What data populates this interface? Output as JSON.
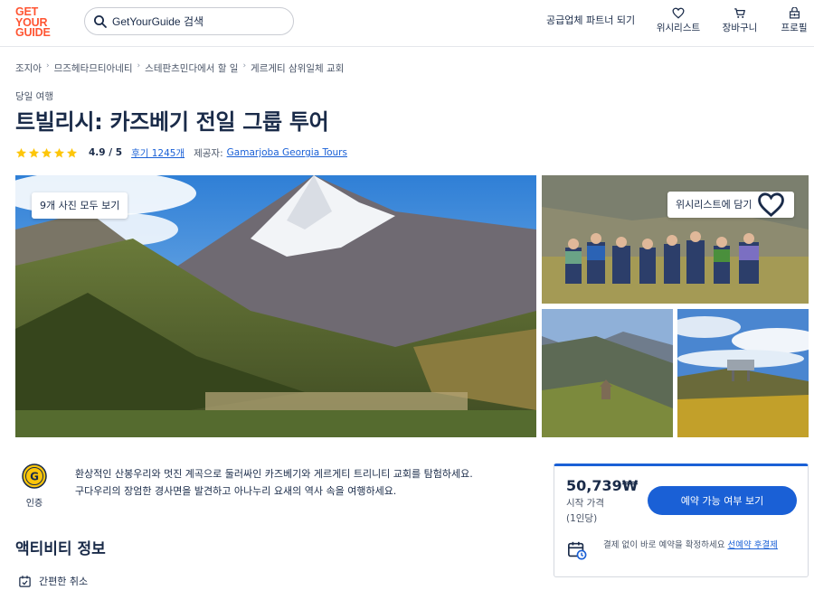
{
  "header": {
    "logo_lines": [
      "GET",
      "YOUR",
      "GUIDE"
    ],
    "search_placeholder": "GetYourGuide 검색",
    "partner_link": "공급업체 파트너 되기",
    "nav": {
      "wishlist": "위시리스트",
      "cart": "장바구니",
      "profile": "프로필"
    }
  },
  "breadcrumb": [
    "조지아",
    "므즈헤타므티아네티",
    "스테판츠민다에서 할 일",
    "게르게티 삼위일체 교회"
  ],
  "activity": {
    "tag": "당일 여행",
    "title": "트빌리시: 카즈베기 전일 그룹 투어",
    "rating_score": "4.9 / 5",
    "stars": 5,
    "reviews_link": "후기 1245개",
    "provider_label": "제공자:",
    "provider_name": "Gamarjoba Georgia Tours"
  },
  "gallery": {
    "show_all_photos": "9개 사진 모두 보기",
    "add_to_wishlist": "위시리스트에 담기"
  },
  "badge": {
    "letter": "G",
    "label": "인증"
  },
  "description": {
    "line1": "환상적인 산봉우리와 멋진 계곡으로 둘러싸인 카즈베기와 게르게티 트리니티 교회를 탐험하세요.",
    "line2": "구다우리의 장엄한 경사면을 발견하고 아나누리 요새의 역사 속을 여행하세요."
  },
  "section": {
    "title": "액티비티 정보",
    "feature_cancel": "간편한 취소"
  },
  "booking": {
    "price": "50,739₩",
    "price_label": "시작 가격",
    "price_unit": "(1인당)",
    "check_button": "예약 가능 여부 보기",
    "reserve_text": "결제 없이 바로 예약을 확정하세요",
    "reserve_link": "선예약 후결제"
  },
  "colors": {
    "brand": "#ff5533",
    "accent": "#1a60d6",
    "text": "#1a2b49",
    "star": "#fdc60a"
  }
}
